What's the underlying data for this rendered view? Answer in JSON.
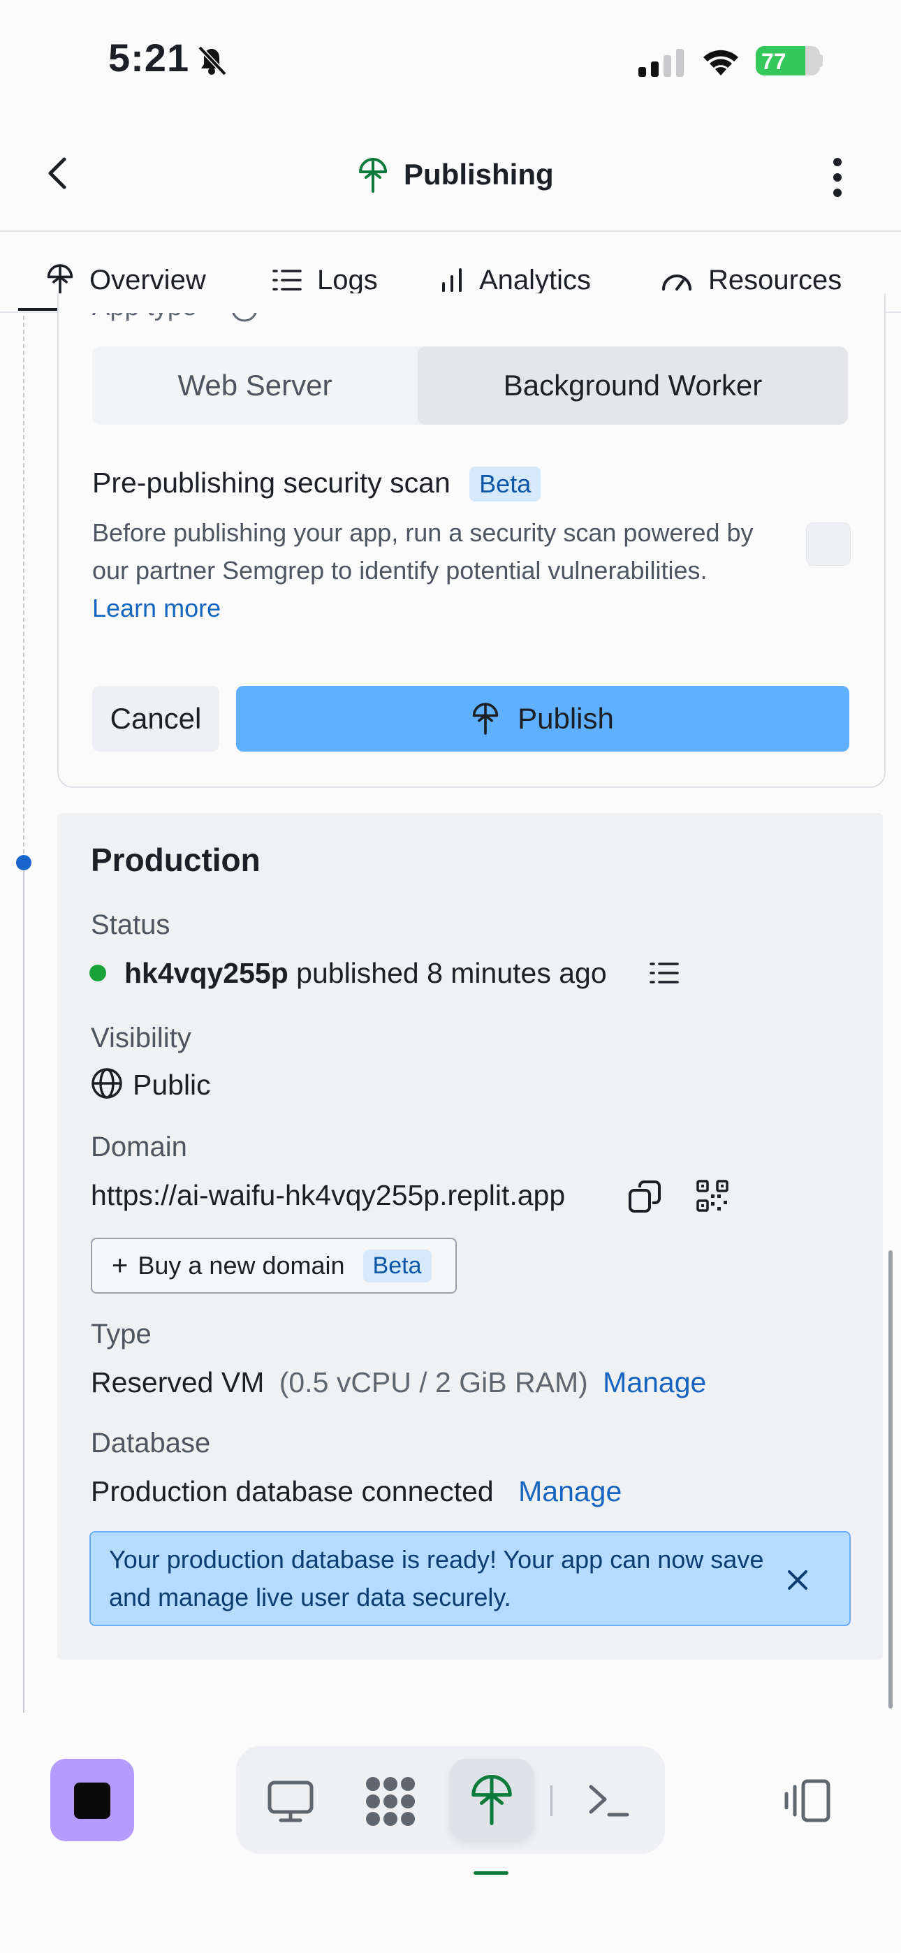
{
  "status_bar": {
    "time": "5:21",
    "battery": "77",
    "battery_level": 0.77
  },
  "header": {
    "title": "Publishing"
  },
  "tabs": [
    {
      "label": "Overview",
      "active": true
    },
    {
      "label": "Logs",
      "active": false
    },
    {
      "label": "Analytics",
      "active": false
    },
    {
      "label": "Resources",
      "active": false
    }
  ],
  "publish_form": {
    "app_type_label": "App type",
    "app_type_options": [
      "Web Server",
      "Background Worker"
    ],
    "app_type_selected": "Background Worker",
    "security_scan": {
      "title": "Pre-publishing security scan",
      "badge": "Beta",
      "description_line1": "Before publishing your app, run a security scan powered by",
      "description_line2": "our partner Semgrep to identify potential vulnerabilities.",
      "learn_more": "Learn more",
      "checked": false
    },
    "cancel_label": "Cancel",
    "publish_label": "Publish"
  },
  "production": {
    "title": "Production",
    "status_label": "Status",
    "deployment_id": "hk4vqy255p",
    "status_text": "published 8 minutes ago",
    "visibility_label": "Visibility",
    "visibility_value": "Public",
    "domain_label": "Domain",
    "domain_value": "https://ai-waifu-hk4vqy255p.replit.app",
    "buy_domain_label": "Buy a new domain",
    "buy_domain_badge": "Beta",
    "type_label": "Type",
    "type_value": "Reserved VM",
    "type_specs": "(0.5 vCPU / 2 GiB RAM)",
    "type_manage": "Manage",
    "database_label": "Database",
    "database_value": "Production database connected",
    "database_manage": "Manage",
    "banner_line1": "Your production database is ready! Your app can now save",
    "banner_line2": "and manage live user data securely."
  },
  "colors": {
    "accent_blue": "#5fb0ff",
    "link_blue": "#1565c0",
    "status_green": "#1aa33a",
    "stop_purple": "#b49cff",
    "publish_icon_green": "#0e7a3b"
  },
  "icons": {
    "back": "chevron-left-icon",
    "publishing": "publishing-tree-icon",
    "more": "more-vertical-icon",
    "logs": "list-icon",
    "analytics": "bar-chart-icon",
    "resources": "gauge-icon",
    "copy": "copy-icon",
    "qr": "qr-code-icon",
    "close": "close-icon",
    "preview": "monitor-icon",
    "workspace": "grid-dots-icon",
    "shell": "terminal-icon",
    "layout": "panel-switch-icon"
  }
}
